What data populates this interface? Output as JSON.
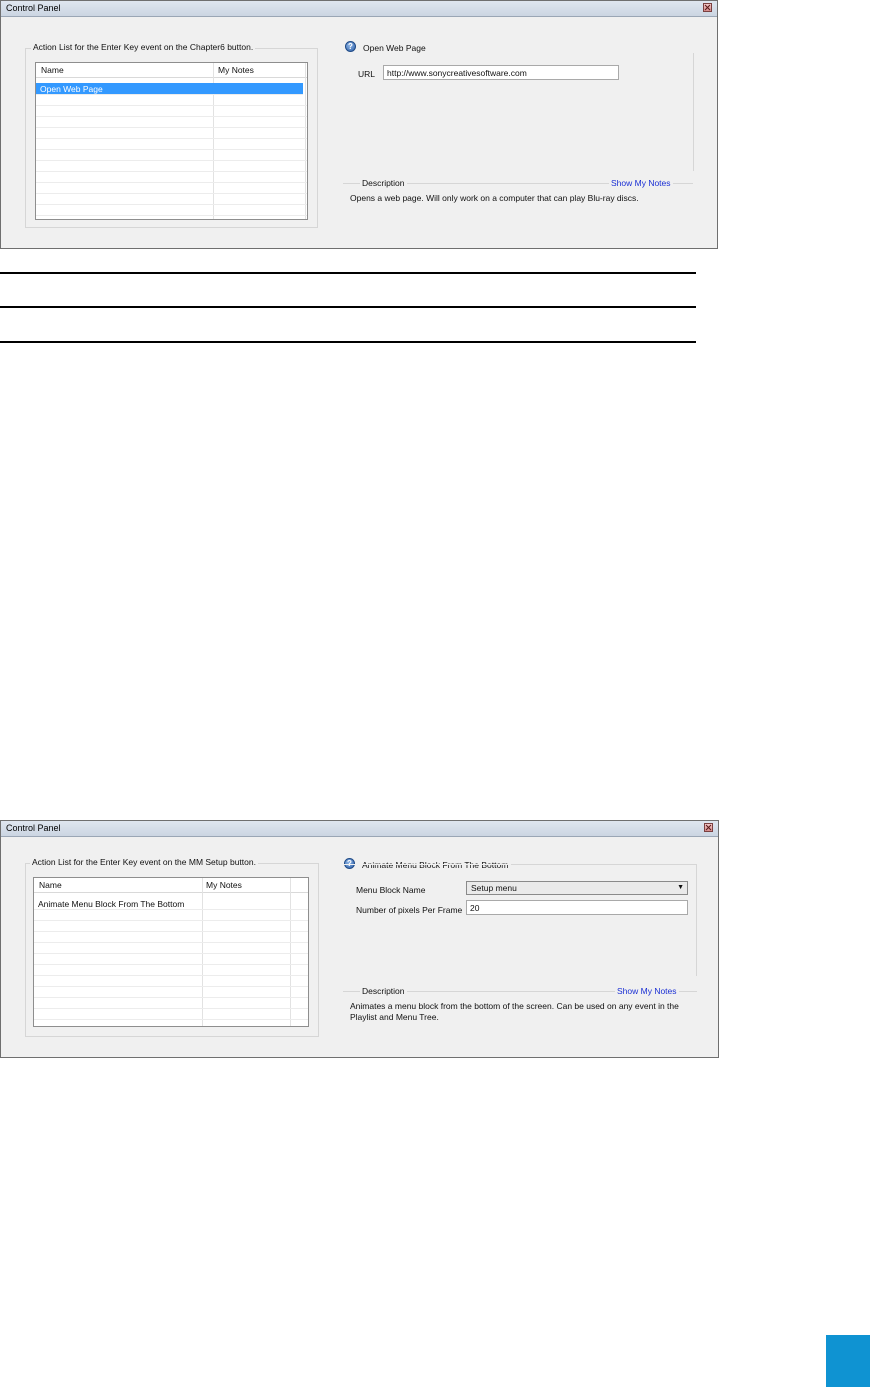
{
  "panel1": {
    "title": "Control Panel",
    "action_list_label": "Action List for the Enter Key event on the Chapter6 button.",
    "columns": [
      "Name",
      "My Notes"
    ],
    "rows": [
      {
        "name": "Open Web Page",
        "notes": "",
        "selected": true
      }
    ],
    "action_title": "Open Web Page",
    "url_label": "URL",
    "url_value": "http://www.sonycreativesoftware.com",
    "description_label": "Description",
    "show_notes_link": "Show My Notes",
    "description_text": "Opens a web page.  Will only work on a computer that can play Blu-ray discs."
  },
  "panel2": {
    "title": "Control Panel",
    "action_list_label": "Action List for the Enter Key event on the MM Setup button.",
    "columns": [
      "Name",
      "My Notes"
    ],
    "rows": [
      {
        "name": "Animate Menu Block From The Bottom",
        "notes": ""
      }
    ],
    "action_title": "Animate Menu Block From The Bottom",
    "menu_block_label": "Menu Block Name",
    "menu_block_value": "Setup menu",
    "pixels_label": "Number of pixels Per Frame",
    "pixels_value": "20",
    "description_label": "Description",
    "show_notes_link": "Show My Notes",
    "description_line1": "Animates a menu block from the bottom of the screen.  Can be used on any event in the",
    "description_line2": "Playlist and Menu Tree."
  },
  "colors": {
    "selection": "#3399ff",
    "link": "#1a2fd4",
    "page_tab": "#0f93d2"
  }
}
